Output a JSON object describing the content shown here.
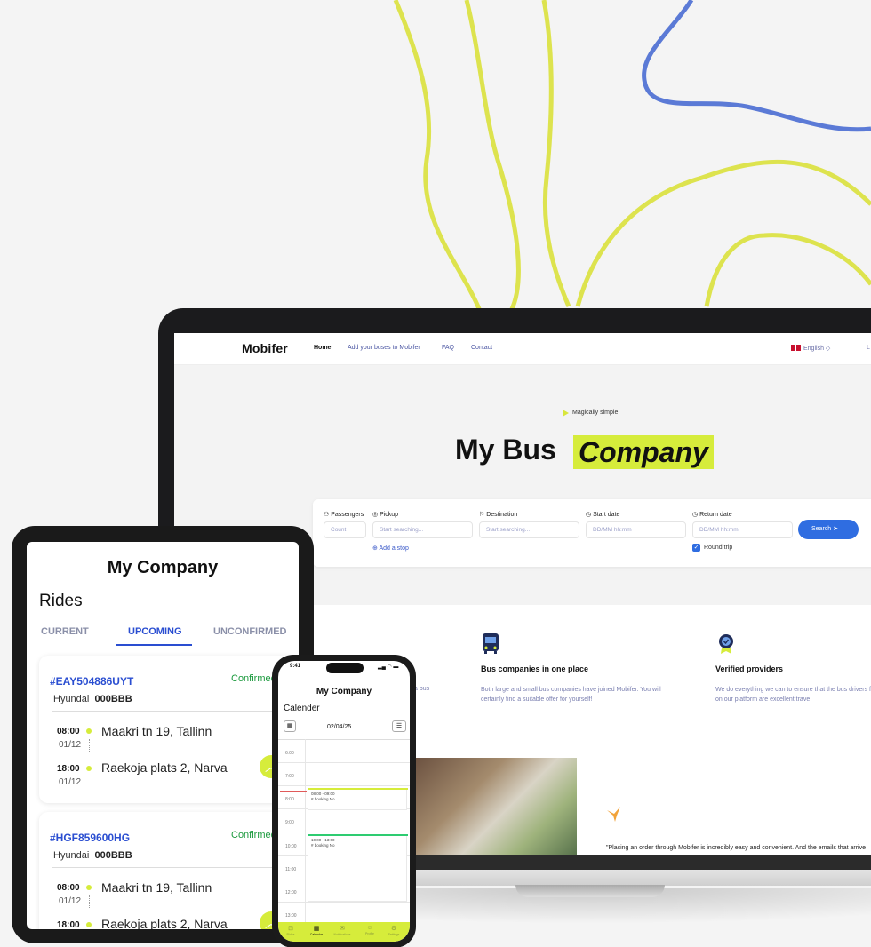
{
  "website": {
    "logo": "Mobifer",
    "nav": [
      "Home",
      "Add your buses to Mobifer",
      "FAQ",
      "Contact"
    ],
    "language": "English",
    "login_fragment": "L",
    "hero_tag": "Magically simple",
    "hero_title_plain": "My Bus",
    "hero_title_highlight": "Company",
    "search": {
      "passengers_label": "Passengers",
      "passengers_placeholder": "Count",
      "pickup_label": "Pickup",
      "pickup_placeholder": "Start searching...",
      "destination_label": "Destination",
      "destination_placeholder": "Start searching...",
      "start_label": "Start date",
      "start_placeholder": "DD/MM hh:mm",
      "return_label": "Return date",
      "return_placeholder": "DD/MM hh:mm",
      "search_button": "Search",
      "add_stop": "Add a stop",
      "round_trip": "Round trip",
      "round_trip_checked": true
    },
    "features": [
      {
        "title": "Bus companies in one place",
        "desc": "Both large and small bus companies have joined Mobifer. You will certainly find a suitable offer for yourself!"
      },
      {
        "title": "Verified providers",
        "desc": "We do everything we can to ensure that the bus drivers found on our platform are excellent trave"
      }
    ],
    "feature_fragment": "a bus",
    "quote": "\"Placing an order through Mobifer is incredibly easy and convenient. And the emails that arrive just before the trip are also pleasant, because then you don't"
  },
  "tablet": {
    "title": "My Company",
    "section": "Rides",
    "tabs": [
      "CURRENT",
      "UPCOMING",
      "UNCONFIRMED"
    ],
    "active_tab": "UPCOMING",
    "rides": [
      {
        "id": "#EAY504886UYT",
        "status": "Confirmed",
        "vehicle": "Hyundai",
        "plate": "000BBB",
        "from_time": "08:00",
        "from_date": "01/12",
        "from_addr": "Maakri tn 19, Tallinn",
        "to_time": "18:00",
        "to_date": "01/12",
        "to_addr": "Raekoja plats 2, Narva"
      },
      {
        "id": "#HGF859600HG",
        "status": "Confirmed",
        "vehicle": "Hyundai",
        "plate": "000BBB",
        "from_time": "08:00",
        "from_date": "01/12",
        "from_addr": "Maakri tn 19, Tallinn",
        "to_time": "18:00",
        "to_date": "",
        "to_addr": "Raekoja plats 2, Narva"
      }
    ]
  },
  "phone": {
    "time": "9:41",
    "title": "My Company",
    "section": "Calender",
    "date": "02/04/25",
    "hours": [
      "6:00",
      "7:00",
      "8:00",
      "9:00",
      "10:00",
      "11:00",
      "12:00",
      "13:00"
    ],
    "events": [
      {
        "time": "08:00 - 09:00",
        "label": "# booking No",
        "color": "#d6ec3b"
      },
      {
        "time": "10:00 - 13:00",
        "label": "# booking No",
        "color": "#2ecc71"
      }
    ],
    "nav": [
      "Rides",
      "Calendar",
      "Notifications",
      "Profile",
      "Settings"
    ],
    "active_nav": "Calendar"
  },
  "colors": {
    "accent": "#d6ec3b",
    "primary": "#2f6de1",
    "confirmed": "#1c9a3e"
  }
}
